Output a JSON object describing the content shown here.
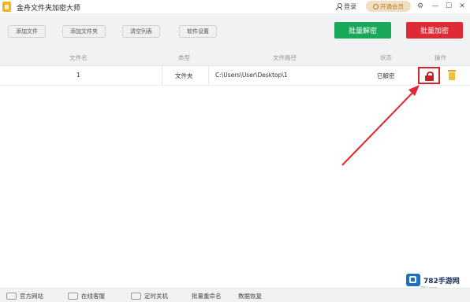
{
  "title_bar": {
    "app_title": "金舟文件夹加密大师",
    "login_label": "登录",
    "vip_label": "开通会员",
    "controls": [
      "settings-icon",
      "minimize-icon",
      "maximize-icon",
      "close-icon"
    ]
  },
  "toolbar": {
    "buttons": [
      "添加文件",
      "添加文件夹",
      "清空列表",
      "软件设置"
    ],
    "batch_decrypt_label": "批量解密",
    "batch_encrypt_label": "批量加密",
    "colors": {
      "decrypt": "#19a85a",
      "encrypt": "#de2a36"
    }
  },
  "table": {
    "columns": [
      "文件名",
      "类型",
      "文件路径",
      "状态",
      "操作"
    ],
    "rows": [
      {
        "name": "1",
        "type": "文件夹",
        "path": "C:\\Users\\User\\Desktop\\1",
        "status": "已解密"
      }
    ]
  },
  "footer": {
    "items": [
      "官方网站",
      "在线客服",
      "定时关机",
      "批量重命名",
      "数据恢复"
    ]
  },
  "watermark": {
    "brand": "782手游网",
    "sub": "782.com"
  }
}
